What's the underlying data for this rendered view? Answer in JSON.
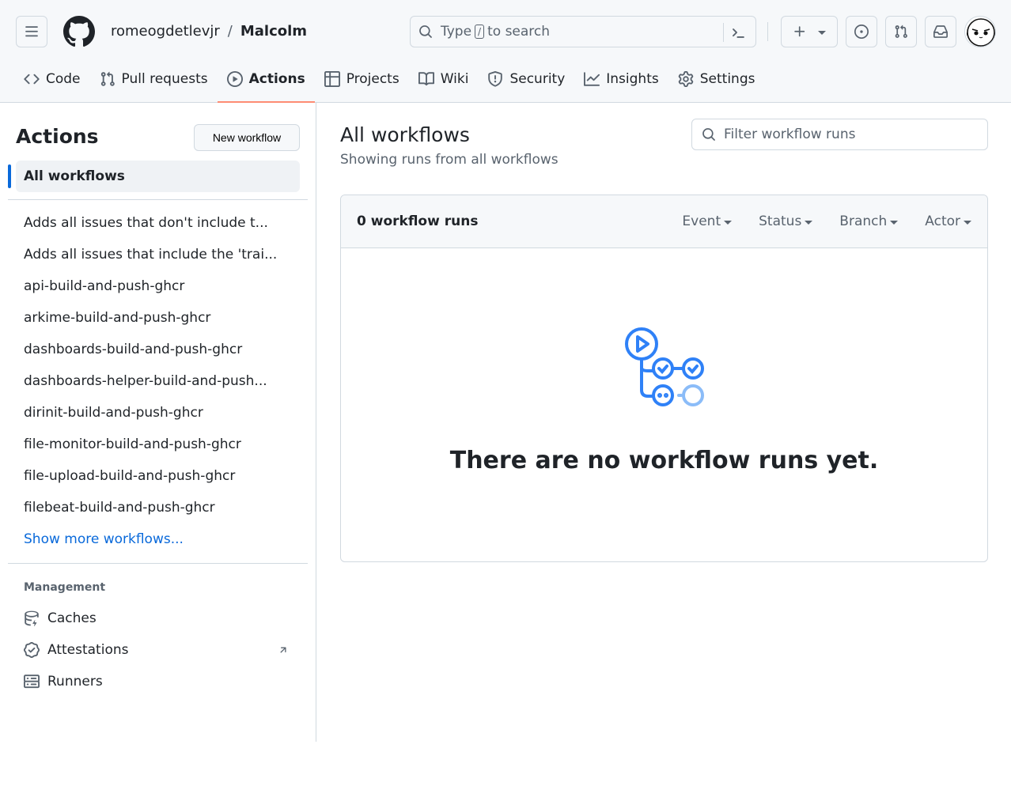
{
  "header": {
    "owner": "romeogdetlevjr",
    "separator": "/",
    "repo": "Malcolm",
    "search": {
      "prefix": "Type",
      "key": "/",
      "suffix": "to search"
    }
  },
  "tabs": [
    {
      "label": "Code",
      "icon": "code-icon"
    },
    {
      "label": "Pull requests",
      "icon": "git-pull-request-icon"
    },
    {
      "label": "Actions",
      "icon": "play-icon",
      "active": true
    },
    {
      "label": "Projects",
      "icon": "table-icon"
    },
    {
      "label": "Wiki",
      "icon": "book-icon"
    },
    {
      "label": "Security",
      "icon": "shield-icon"
    },
    {
      "label": "Insights",
      "icon": "graph-icon"
    },
    {
      "label": "Settings",
      "icon": "gear-icon"
    }
  ],
  "sidebar": {
    "title": "Actions",
    "new_workflow_label": "New workflow",
    "all_workflows_label": "All workflows",
    "workflows": [
      "Adds all issues that don't include t...",
      "Adds all issues that include the 'trai...",
      "api-build-and-push-ghcr",
      "arkime-build-and-push-ghcr",
      "dashboards-build-and-push-ghcr",
      "dashboards-helper-build-and-push...",
      "dirinit-build-and-push-ghcr",
      "file-monitor-build-and-push-ghcr",
      "file-upload-build-and-push-ghcr",
      "filebeat-build-and-push-ghcr"
    ],
    "show_more_label": "Show more workflows...",
    "management_title": "Management",
    "management": [
      {
        "label": "Caches",
        "icon": "database-icon"
      },
      {
        "label": "Attestations",
        "icon": "verified-icon",
        "external": true
      },
      {
        "label": "Runners",
        "icon": "server-icon"
      }
    ]
  },
  "main": {
    "title": "All workflows",
    "subtitle": "Showing runs from all workflows",
    "filter_placeholder": "Filter workflow runs",
    "runs_count_label": "0 workflow runs",
    "filters": [
      "Event",
      "Status",
      "Branch",
      "Actor"
    ],
    "empty_message": "There are no workflow runs yet."
  },
  "colors": {
    "accent": "#0969da",
    "tab_underline": "#fd8c73",
    "empty_icon": "#2f81f7"
  }
}
